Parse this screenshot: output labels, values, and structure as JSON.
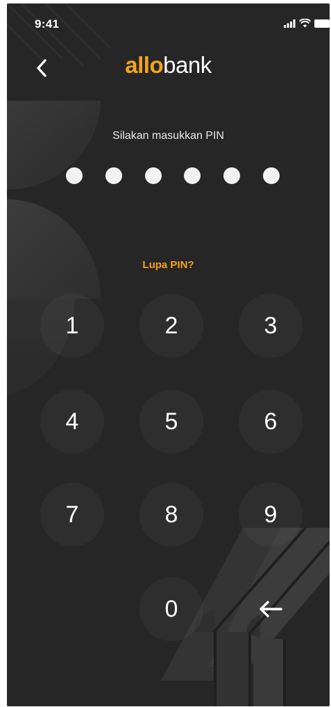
{
  "status_bar": {
    "time": "9:41"
  },
  "header": {
    "logo_part1": "allo",
    "logo_part2": "bank"
  },
  "pin": {
    "prompt": "Silakan masukkan PIN",
    "digit_count": 6,
    "forgot_label": "Lupa PIN?"
  },
  "keypad": {
    "k1": "1",
    "k2": "2",
    "k3": "3",
    "k4": "4",
    "k5": "5",
    "k6": "6",
    "k7": "7",
    "k8": "8",
    "k9": "9",
    "k0": "0"
  },
  "colors": {
    "background": "#262626",
    "accent": "#f5a21b",
    "text": "#ffffff"
  },
  "icons": {
    "back": "chevron-left-icon",
    "backspace": "arrow-left-icon"
  }
}
